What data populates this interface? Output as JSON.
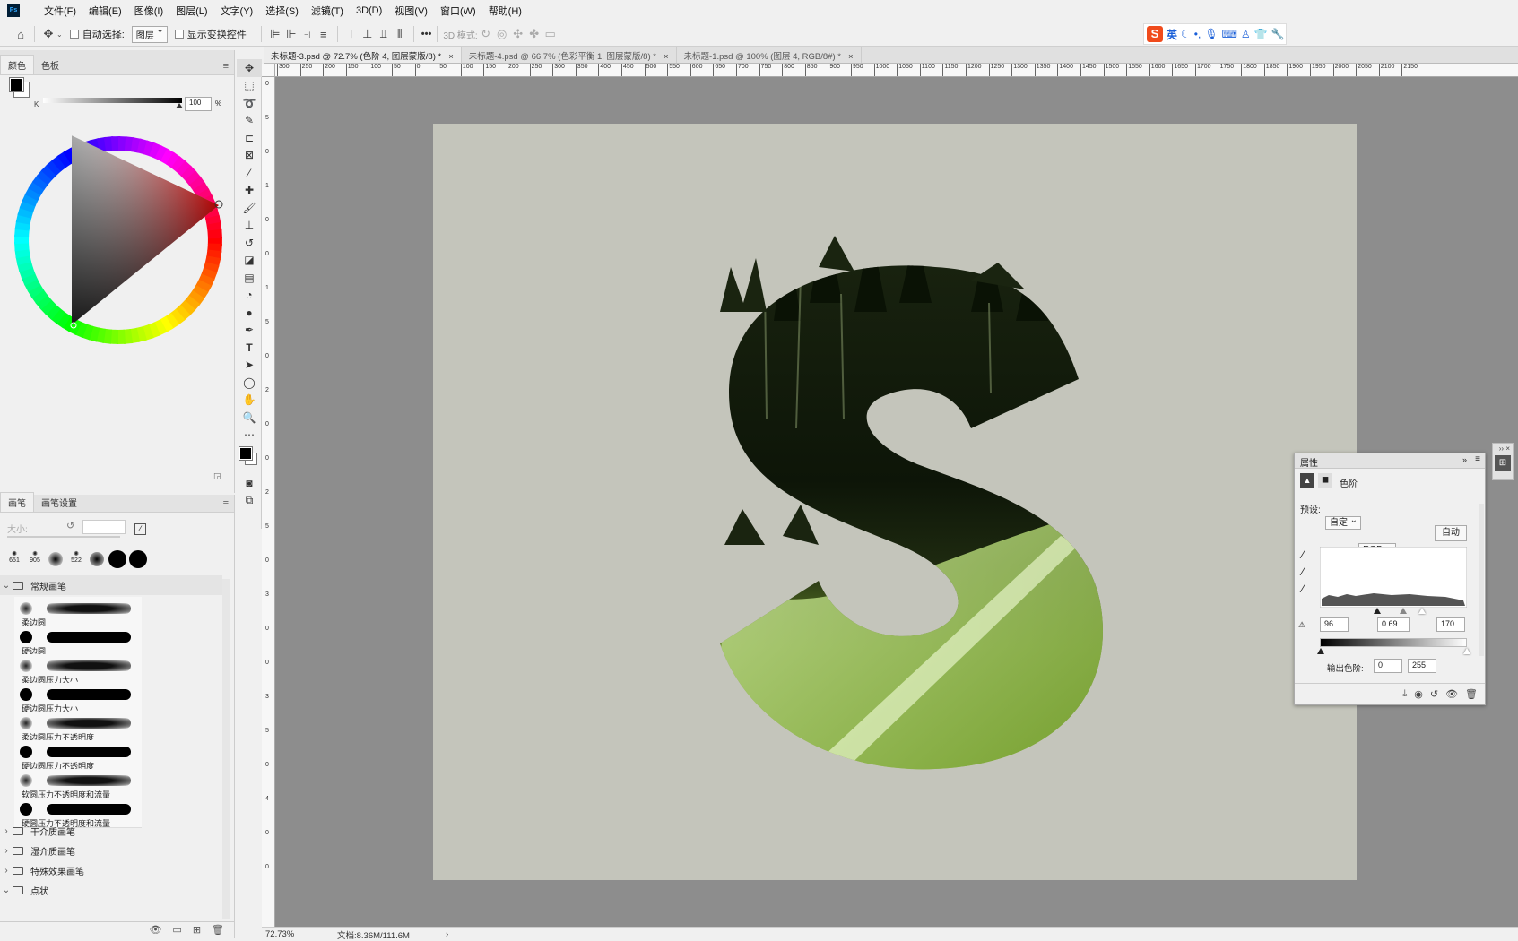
{
  "menubar": {
    "logo": "Ps",
    "items": [
      "文件(F)",
      "编辑(E)",
      "图像(I)",
      "图层(L)",
      "文字(Y)",
      "选择(S)",
      "滤镜(T)",
      "3D(D)",
      "视图(V)",
      "窗口(W)",
      "帮助(H)"
    ]
  },
  "options": {
    "auto_select_label": "自动选择:",
    "layer_select": "图层",
    "show_transform_label": "显示变换控件",
    "more": "•••",
    "mode_3d_label": "3D 模式:"
  },
  "ime": {
    "logo": "S",
    "lang": "英"
  },
  "color_panel": {
    "tabs": [
      "颜色",
      "色板"
    ],
    "slider_label": "K",
    "slider_value": "100",
    "slider_unit": "%"
  },
  "brush_panel": {
    "tabs": [
      "画笔",
      "画笔设置"
    ],
    "size_label": "大小:",
    "presets": [
      "651",
      "905",
      "",
      "522",
      "",
      "",
      ""
    ],
    "group_open": "常规画笔",
    "brushes": [
      "柔边圆",
      "硬边圆",
      "柔边圆压力大小",
      "硬边圆压力大小",
      "柔边圆压力不透明度",
      "硬边圆压力不透明度",
      "软圆压力不透明度和流量",
      "硬圆压力不透明度和流量"
    ],
    "groups_closed": [
      "干介质画笔",
      "湿介质画笔",
      "特殊效果画笔"
    ],
    "group_last": "点状"
  },
  "document": {
    "tabs": [
      {
        "title": "未标题-3.psd @ 72.7% (色阶 4, 图层蒙版/8) *",
        "close": "×"
      },
      {
        "title": "未标题-4.psd @ 66.7% (色彩平衡 1, 图层蒙版/8) *",
        "close": "×"
      },
      {
        "title": "未标题-1.psd @ 100% (图层 4, RGB/8#) *",
        "close": "×"
      }
    ],
    "ruler_h": [
      "300",
      "250",
      "200",
      "150",
      "100",
      "50",
      "0",
      "50",
      "100",
      "150",
      "200",
      "250",
      "300",
      "350",
      "400",
      "450",
      "500",
      "550",
      "600",
      "650",
      "700",
      "750",
      "800",
      "850",
      "900",
      "950",
      "1000",
      "1050",
      "1100",
      "1150",
      "1200",
      "1250",
      "1300",
      "1350",
      "1400",
      "1450",
      "1500",
      "1550",
      "1600",
      "1650",
      "1700",
      "1750",
      "1800",
      "1850",
      "1900",
      "1950",
      "2000",
      "2050",
      "2100",
      "2150"
    ],
    "ruler_v": [
      "0",
      "5",
      "0",
      "1",
      "0",
      "0",
      "1",
      "5",
      "0",
      "2",
      "0",
      "0",
      "2",
      "5",
      "0",
      "3",
      "0",
      "0",
      "3",
      "5",
      "0",
      "4",
      "0",
      "0"
    ],
    "letter": "S",
    "colors": {
      "canvas": "#c4c5bb",
      "workspace": "#8d8d8d"
    }
  },
  "status": {
    "zoom": "72.73%",
    "doc": "文档:8.36M/111.6M",
    "arrow": "›"
  },
  "properties": {
    "title": "属性",
    "layer_type": "色阶",
    "preset_label": "预设:",
    "preset_value": "自定",
    "channel": "RGB",
    "auto_button": "自动",
    "input_black": "96",
    "input_gamma": "0.69",
    "input_white": "170",
    "output_label": "输出色阶:",
    "output_black": "0",
    "output_white": "255"
  }
}
